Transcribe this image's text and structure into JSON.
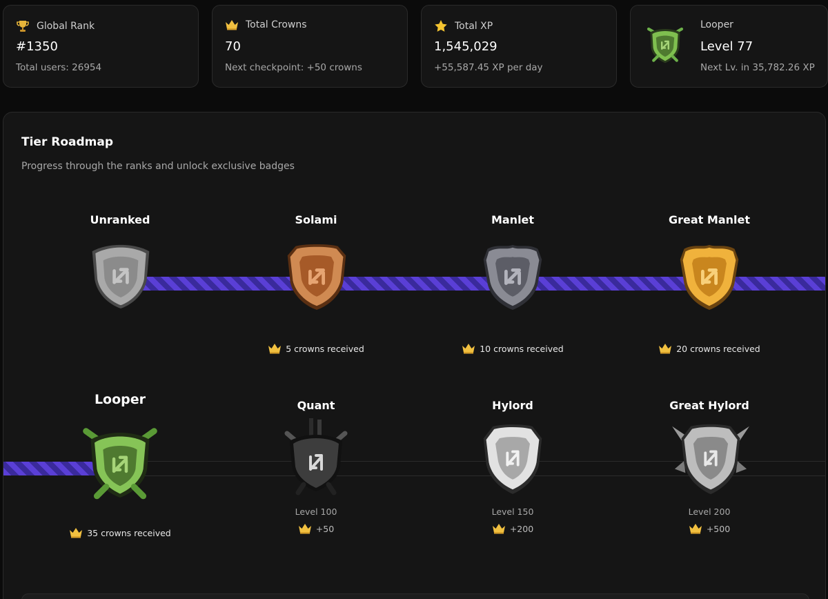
{
  "stats": {
    "global_rank": {
      "label": "Global Rank",
      "value": "#1350",
      "sub": "Total users: 26954",
      "icon": "trophy-icon"
    },
    "total_crowns": {
      "label": "Total Crowns",
      "value": "70",
      "sub": "Next checkpoint: +50 crowns",
      "icon": "crown-icon"
    },
    "total_xp": {
      "label": "Total XP",
      "value": "1,545,029",
      "sub": "+55,587.45 XP per day",
      "icon": "star-icon"
    },
    "level": {
      "label": "Looper",
      "value": "Level 77",
      "sub": "Next Lv. in 35,782.26 XP",
      "icon": "looper-badge-icon"
    }
  },
  "roadmap": {
    "title": "Tier Roadmap",
    "subtitle": "Progress through the ranks and unlock exclusive badges",
    "tiers": [
      {
        "name": "Unranked",
        "requirement": "",
        "status": "achieved",
        "color": "#9a9a9a"
      },
      {
        "name": "Solami",
        "requirement": "5 crowns received",
        "status": "achieved",
        "color": "#c97b3e"
      },
      {
        "name": "Manlet",
        "requirement": "10 crowns received",
        "status": "achieved",
        "color": "#6f7078"
      },
      {
        "name": "Great Manlet",
        "requirement": "20 crowns received",
        "status": "achieved",
        "color": "#e0a02e"
      },
      {
        "name": "Looper",
        "requirement": "35 crowns received",
        "status": "current",
        "color": "#79b34a"
      },
      {
        "name": "Quant",
        "level": "Level 100",
        "bonus": "+50",
        "status": "locked",
        "color": "#3a3a3a"
      },
      {
        "name": "Hylord",
        "level": "Level 150",
        "bonus": "+200",
        "status": "locked",
        "color": "#d8d8d8"
      },
      {
        "name": "Great Hylord",
        "level": "Level 200",
        "bonus": "+500",
        "status": "locked",
        "color": "#b5b5b5"
      }
    ]
  },
  "colors": {
    "accent": "#5a3fd6",
    "card_bg": "#151515",
    "page_bg": "#0b0b0b"
  }
}
